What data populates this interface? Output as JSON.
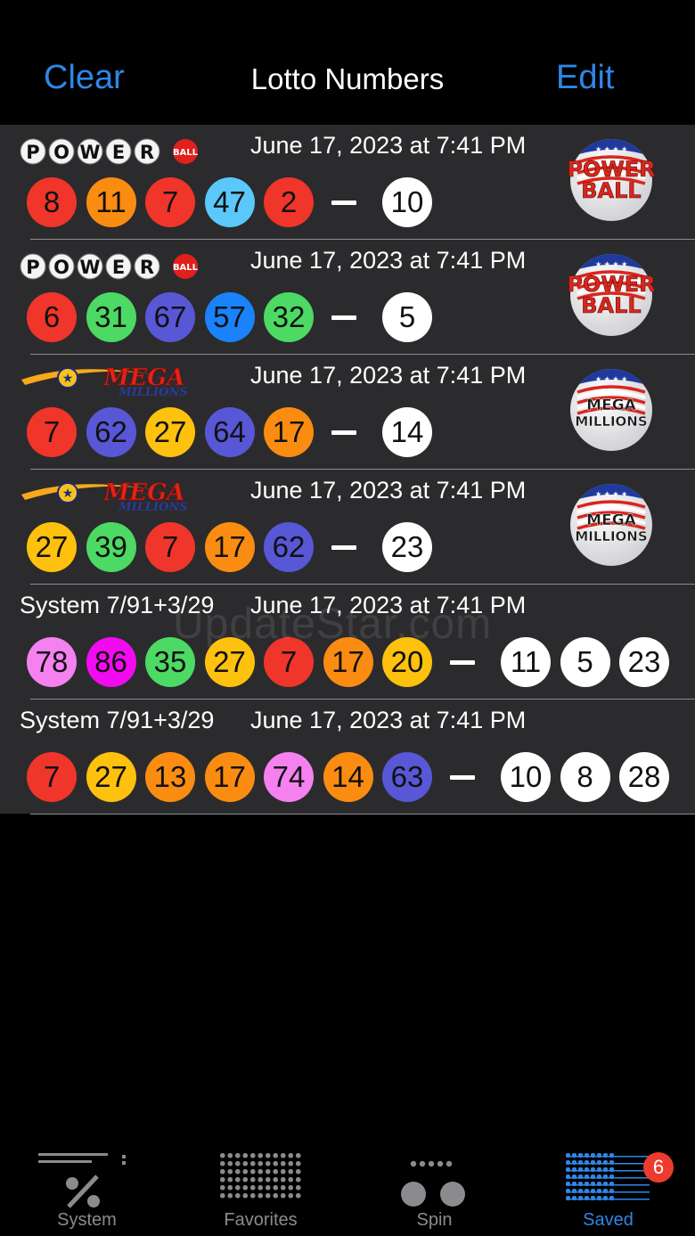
{
  "nav": {
    "left_button": "Clear",
    "title": "Lotto Numbers",
    "right_button": "Edit"
  },
  "watermark": "UpdateStar.com",
  "colors": {
    "accent": "#2f86e6",
    "red": "#f0352a",
    "orange": "#fb8c12",
    "yellow": "#fdc10e",
    "green": "#4cd964",
    "purple": "#5857d6",
    "skyblue": "#5ac8fa",
    "blue": "#1a82fb",
    "pink": "#f581f0",
    "magenta": "#f20bf0",
    "white": "#ffffff",
    "badge": "#ee3b30"
  },
  "entries": [
    {
      "game": "powerball",
      "logo_text": "POWERBALL",
      "icon_text": [
        "POWER",
        "BALL"
      ],
      "label": "",
      "date": "June 17, 2023 at 7:41 PM",
      "main": [
        {
          "n": "8",
          "c": "red"
        },
        {
          "n": "11",
          "c": "orange"
        },
        {
          "n": "7",
          "c": "red"
        },
        {
          "n": "47",
          "c": "skyblue"
        },
        {
          "n": "2",
          "c": "red"
        }
      ],
      "bonus": [
        "10"
      ]
    },
    {
      "game": "powerball",
      "logo_text": "POWERBALL",
      "icon_text": [
        "POWER",
        "BALL"
      ],
      "label": "",
      "date": "June 17, 2023 at 7:41 PM",
      "main": [
        {
          "n": "6",
          "c": "red"
        },
        {
          "n": "31",
          "c": "green"
        },
        {
          "n": "67",
          "c": "purple"
        },
        {
          "n": "57",
          "c": "blue"
        },
        {
          "n": "32",
          "c": "green"
        }
      ],
      "bonus": [
        "5"
      ]
    },
    {
      "game": "megamillions",
      "logo_text": "MEGA MILLIONS",
      "icon_text": [
        "MEGA",
        "MILLIONS"
      ],
      "label": "",
      "date": "June 17, 2023 at 7:41 PM",
      "main": [
        {
          "n": "7",
          "c": "red"
        },
        {
          "n": "62",
          "c": "purple"
        },
        {
          "n": "27",
          "c": "yellow"
        },
        {
          "n": "64",
          "c": "purple"
        },
        {
          "n": "17",
          "c": "orange"
        }
      ],
      "bonus": [
        "14"
      ]
    },
    {
      "game": "megamillions",
      "logo_text": "MEGA MILLIONS",
      "icon_text": [
        "MEGA",
        "MILLIONS"
      ],
      "label": "",
      "date": "June 17, 2023 at 7:41 PM",
      "main": [
        {
          "n": "27",
          "c": "yellow"
        },
        {
          "n": "39",
          "c": "green"
        },
        {
          "n": "7",
          "c": "red"
        },
        {
          "n": "17",
          "c": "orange"
        },
        {
          "n": "62",
          "c": "purple"
        }
      ],
      "bonus": [
        "23"
      ]
    },
    {
      "game": "system",
      "label": "System 7/91+3/29",
      "date": "June 17, 2023 at 7:41 PM",
      "main": [
        {
          "n": "78",
          "c": "pink"
        },
        {
          "n": "86",
          "c": "magenta"
        },
        {
          "n": "35",
          "c": "green"
        },
        {
          "n": "27",
          "c": "yellow"
        },
        {
          "n": "7",
          "c": "red"
        },
        {
          "n": "17",
          "c": "orange"
        },
        {
          "n": "20",
          "c": "yellow"
        }
      ],
      "bonus": [
        "11",
        "5",
        "23"
      ]
    },
    {
      "game": "system",
      "label": "System 7/91+3/29",
      "date": "June 17, 2023 at 7:41 PM",
      "main": [
        {
          "n": "7",
          "c": "red"
        },
        {
          "n": "27",
          "c": "yellow"
        },
        {
          "n": "13",
          "c": "orange"
        },
        {
          "n": "17",
          "c": "orange"
        },
        {
          "n": "74",
          "c": "pink"
        },
        {
          "n": "14",
          "c": "orange"
        },
        {
          "n": "63",
          "c": "purple"
        }
      ],
      "bonus": [
        "10",
        "8",
        "28"
      ]
    }
  ],
  "tabs": [
    {
      "label": "System",
      "icon": "system-percent-icon",
      "active": false
    },
    {
      "label": "Favorites",
      "icon": "favorites-grid-icon",
      "active": false
    },
    {
      "label": "Spin",
      "icon": "spin-balls-icon",
      "active": false
    },
    {
      "label": "Saved",
      "icon": "saved-lines-icon",
      "active": true
    }
  ],
  "saved_badge": "6"
}
